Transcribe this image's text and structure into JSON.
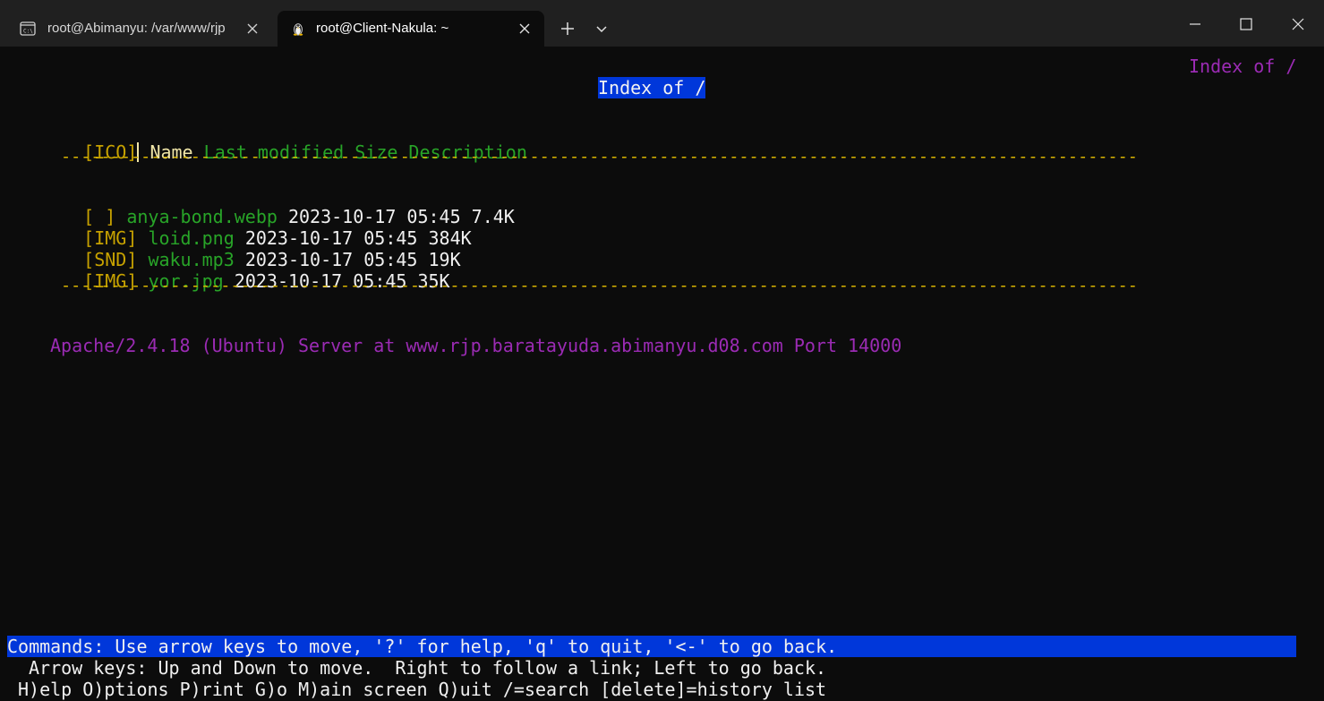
{
  "tabs": [
    {
      "label": "root@Abimanyu: /var/www/rjp",
      "icon": "terminal-icon",
      "active": false
    },
    {
      "label": "root@Client-Nakula: ~",
      "icon": "linux-penguin-icon",
      "active": true
    }
  ],
  "terminal": {
    "corner_title": "Index of /",
    "page_title": "Index of /",
    "header": {
      "ico": "[ICO]",
      "name": "Name",
      "rest": "Last modified Size Description"
    },
    "rule": "------------------------------------------------------------------------------------------------------------",
    "rows": [
      {
        "icon": "[ ]",
        "name": "anya-bond.webp",
        "info": "2023-10-17 05:45 7.4K"
      },
      {
        "icon": "[IMG]",
        "name": "loid.png",
        "info": "2023-10-17 05:45 384K"
      },
      {
        "icon": "[SND]",
        "name": "waku.mp3",
        "info": "2023-10-17 05:45 19K"
      },
      {
        "icon": "[IMG]",
        "name": "yor.jpg",
        "info": "2023-10-17 05:45 35K"
      }
    ],
    "footer": "Apache/2.4.18 (Ubuntu) Server at www.rjp.baratayuda.abimanyu.d08.com Port 14000",
    "commands": "Commands: Use arrow keys to move, '?' for help, 'q' to quit, '<-' to go back.",
    "arrows": "Arrow keys: Up and Down to move.  Right to follow a link; Left to go back.",
    "menu": "H)elp O)ptions P)rint G)o M)ain screen Q)uit /=search [delete]=history list"
  },
  "colors": {
    "background": "#0c0c0c",
    "titlebar": "#202020",
    "highlight": "#0037da",
    "link_green": "#28a428",
    "icon_yellow": "#c7a200",
    "accent_purple": "#9b2bb4"
  }
}
